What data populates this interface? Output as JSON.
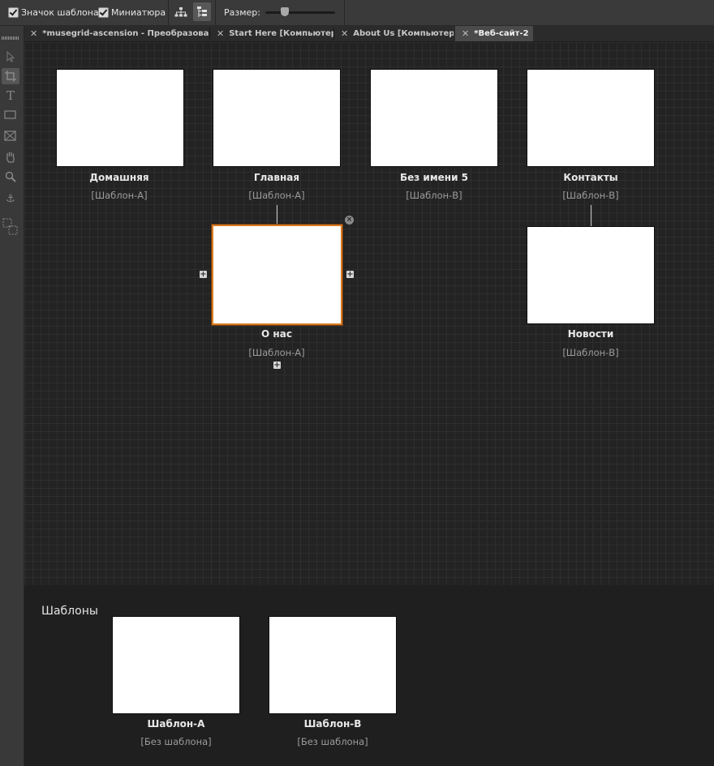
{
  "toolbar": {
    "master_icon_checkbox": {
      "label": "Значок шаблона",
      "checked": true
    },
    "thumbnail_checkbox": {
      "label": "Миниатюра",
      "checked": true
    },
    "size_label": "Размер:",
    "size_slider_value": 0.28
  },
  "tabs": [
    {
      "label": "*musegrid-ascension - Преобразован",
      "active": false
    },
    {
      "label": "Start Here [Компьютер]",
      "active": false
    },
    {
      "label": "About Us [Компьютер]",
      "active": false
    },
    {
      "label": "*Веб-сайт-2",
      "active": true
    }
  ],
  "tools": [
    "selection-tool",
    "crop-tool",
    "text-tool",
    "rectangle-tool",
    "rectangle-frame-tool",
    "hand-tool",
    "zoom-tool",
    "anchor-tool",
    "fit-frame-tool"
  ],
  "pages": [
    {
      "name": "Домашняя",
      "template": "[Шаблон-A]"
    },
    {
      "name": "Главная",
      "template": "[Шаблон-A]"
    },
    {
      "name": "Без имени 5",
      "template": "[Шаблон-B]"
    },
    {
      "name": "Контакты",
      "template": "[Шаблон-B]"
    },
    {
      "name": "О нас",
      "template": "[Шаблон-A]"
    },
    {
      "name": "Новости",
      "template": "[Шаблон-B]"
    }
  ],
  "templates_section": {
    "title": "Шаблоны",
    "items": [
      {
        "name": "Шаблон-A",
        "template": "[Без шаблона]"
      },
      {
        "name": "Шаблон-B",
        "template": "[Без шаблона]"
      }
    ]
  },
  "colors": {
    "selection_outline": "#d97b22",
    "canvas_bg": "#232323",
    "grid_line": "#2e2e2e"
  }
}
